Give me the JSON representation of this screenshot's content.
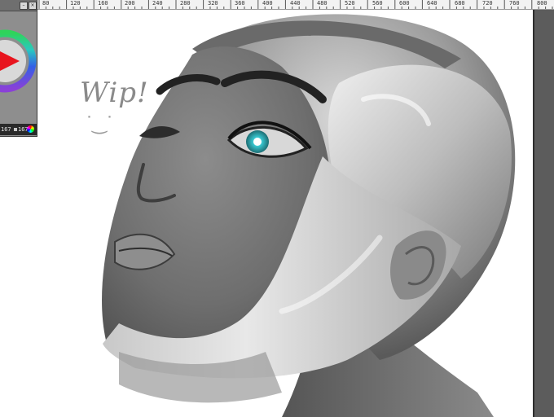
{
  "ruler": {
    "labels": [
      "80",
      "120",
      "160",
      "200",
      "240",
      "280",
      "320",
      "360",
      "400",
      "440",
      "480",
      "520",
      "560",
      "600",
      "640",
      "680",
      "720",
      "760",
      "800"
    ]
  },
  "canvas": {
    "note_text": "Wip!",
    "smiley_text": "˙ ͜ ˙"
  },
  "color_panel": {
    "value_left": "167",
    "value_right": "167",
    "current_color": "#e8141e"
  },
  "icons": {
    "minimize": "minimize-icon",
    "close": "close-icon",
    "color_wheel": "color-wheel-icon"
  }
}
